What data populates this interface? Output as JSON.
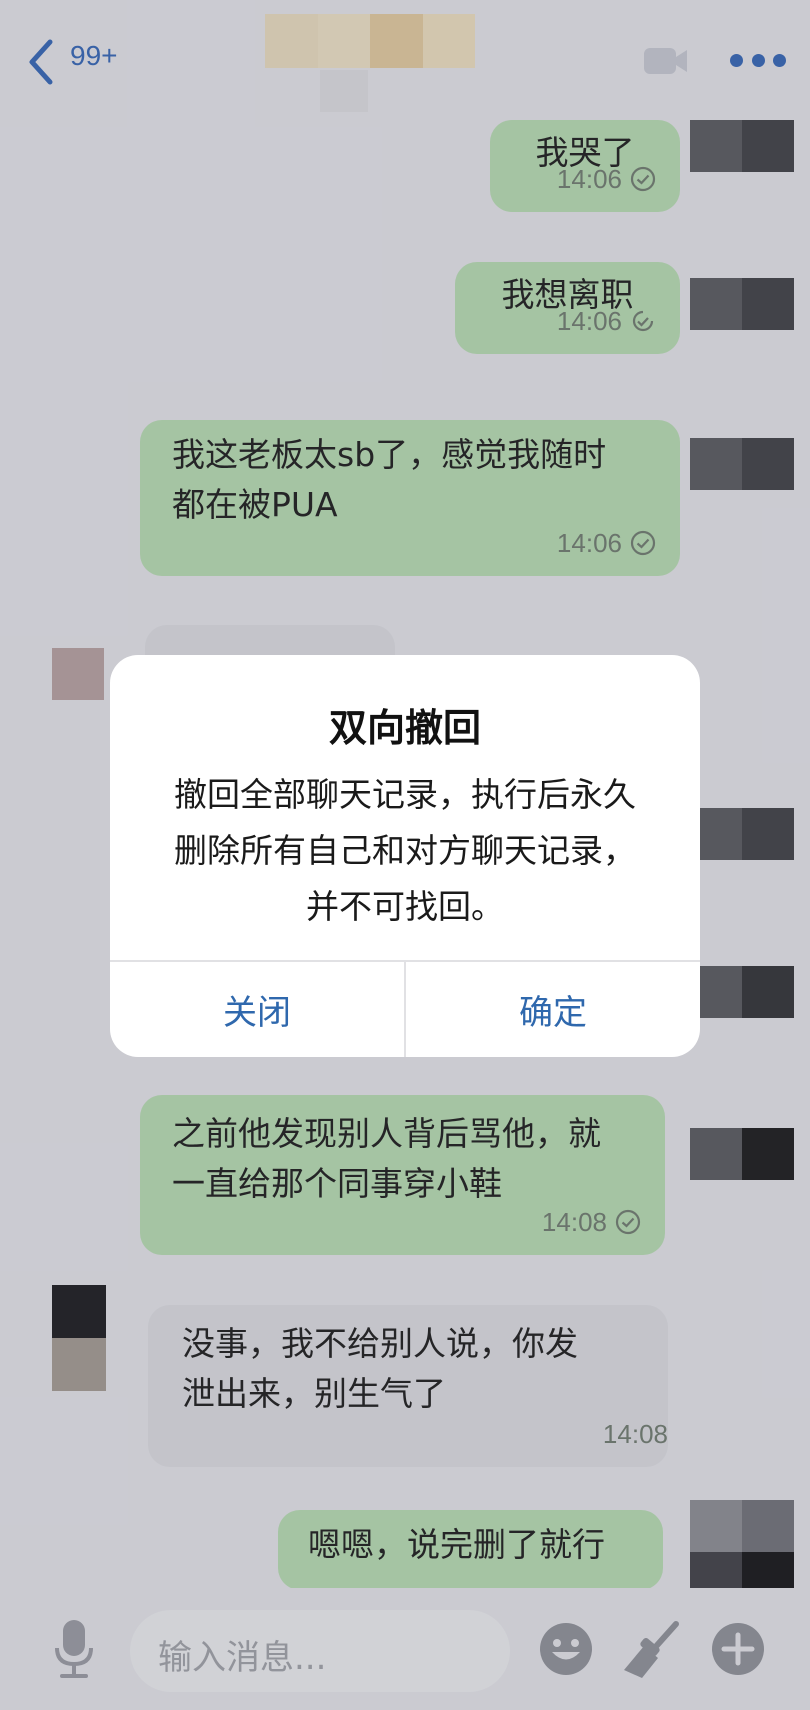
{
  "header": {
    "unread_badge": "99+"
  },
  "messages": [
    {
      "side": "me",
      "text": "我哭了",
      "time": "14:06"
    },
    {
      "side": "me",
      "text": "我想离职",
      "time": "14:06"
    },
    {
      "side": "me",
      "text": "我这老板太sb了，感觉我随时都在被PUA",
      "time": "14:06"
    },
    {
      "side": "other",
      "text": "",
      "time": ""
    },
    {
      "side": "me",
      "text": "之前他发现别人背后骂他，就一直给那个同事穿小鞋",
      "time": "14:08"
    },
    {
      "side": "other",
      "text": "没事，我不给别人说，你发泄出来，别生气了",
      "time": "14:08"
    },
    {
      "side": "me",
      "text": "嗯嗯，说完删了就行",
      "time": ""
    }
  ],
  "input": {
    "placeholder": "输入消息..."
  },
  "dialog": {
    "title": "双向撤回",
    "message": "撤回全部聊天记录，执行后永久删除所有自己和对方聊天记录，并不可找回。",
    "cancel_label": "关闭",
    "confirm_label": "确定"
  },
  "colors": {
    "accent": "#2f63b8",
    "my_bubble": "#b9e0b4",
    "other_bubble": "#e0e1e6",
    "dialog_button": "#2f68ad"
  }
}
